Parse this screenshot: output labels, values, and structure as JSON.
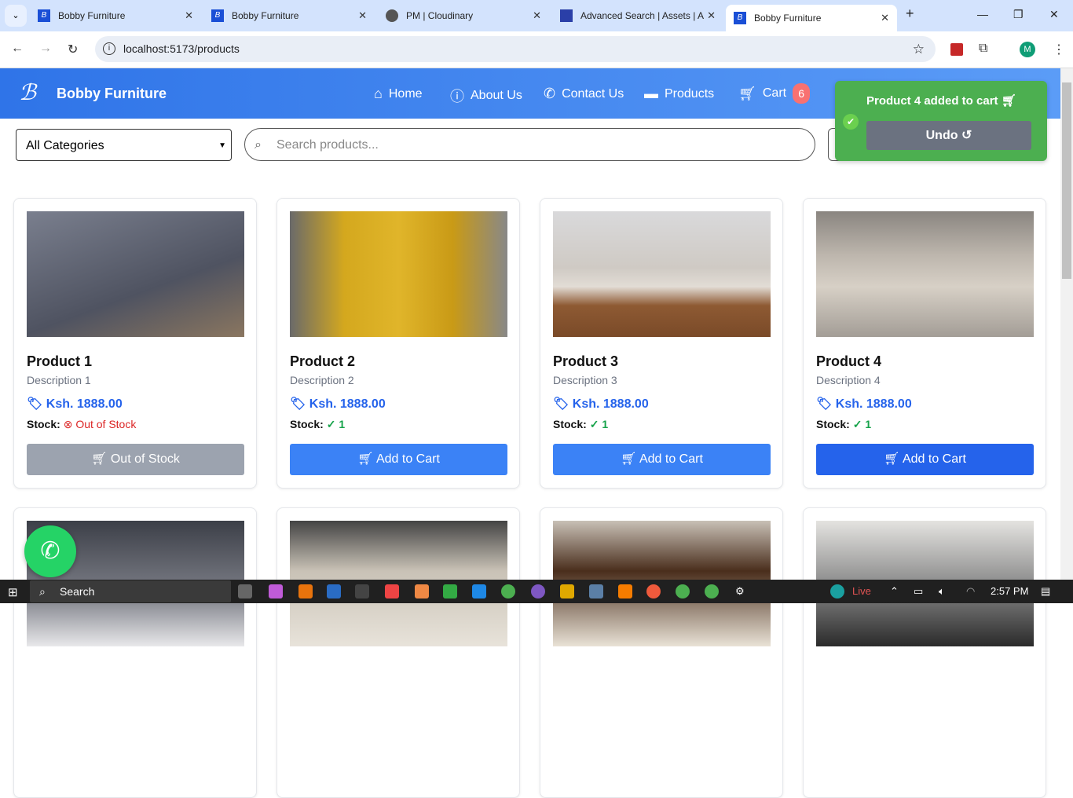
{
  "browser": {
    "tabs": [
      {
        "title": "Bobby Furniture",
        "icon": "bobby-logo"
      },
      {
        "title": "Bobby Furniture",
        "icon": "bobby-logo"
      },
      {
        "title": "PM | Cloudinary",
        "icon": "globe"
      },
      {
        "title": "Advanced Search | Assets | A",
        "icon": "assets-logo"
      },
      {
        "title": "Bobby Furniture",
        "icon": "bobby-logo",
        "active": true
      }
    ],
    "url": "localhost:5173/products",
    "profile": "M"
  },
  "navbar": {
    "brand": "Bobby Furniture",
    "items": [
      {
        "label": "Home",
        "icon": "home-icon"
      },
      {
        "label": "About Us",
        "icon": "info-icon"
      },
      {
        "label": "Contact Us",
        "icon": "phone-icon"
      },
      {
        "label": "Products",
        "icon": "couch-icon"
      },
      {
        "label": "Cart",
        "icon": "cart-icon"
      }
    ],
    "cart_count": "6"
  },
  "filters": {
    "category": "All Categories",
    "search_placeholder": "Search products..."
  },
  "products": [
    {
      "name": "Product 1",
      "description": "Description 1",
      "price": "Ksh. 1888.00",
      "stock_label": "Stock:",
      "stock": "Out of Stock",
      "button": "Out of Stock",
      "color": "#5d6170"
    },
    {
      "name": "Product 2",
      "description": "Description 2",
      "price": "Ksh. 1888.00",
      "stock_label": "Stock:",
      "stock": "1",
      "button": "Add to Cart",
      "color": "#c9a21c"
    },
    {
      "name": "Product 3",
      "description": "Description 3",
      "price": "Ksh. 1888.00",
      "stock_label": "Stock:",
      "stock": "1",
      "button": "Add to Cart",
      "color": "#b59a80"
    },
    {
      "name": "Product 4",
      "description": "Description 4",
      "price": "Ksh. 1888.00",
      "stock_label": "Stock:",
      "stock": "1",
      "button": "Add to Cart",
      "color": "#a49f98"
    }
  ],
  "toast": {
    "message": "Product 4  added to cart",
    "undo": "Undo"
  },
  "taskbar": {
    "search": "Search",
    "live": "Live",
    "time": "2:57 PM"
  }
}
